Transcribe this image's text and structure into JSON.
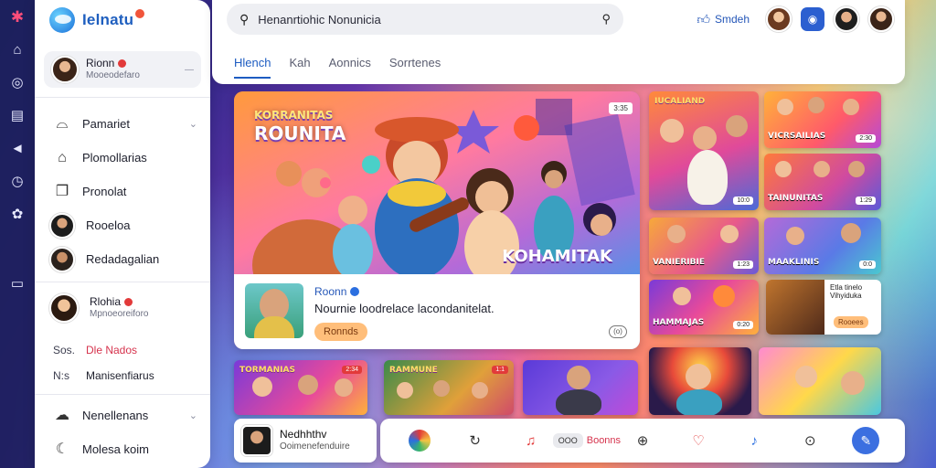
{
  "app": {
    "brand_name": "Ielnatu",
    "search_value": "Henanrtiohic Nonunicia"
  },
  "header": {
    "subscribe_label": "Smdeh",
    "tabs": [
      {
        "label": "Hlench",
        "active": true
      },
      {
        "label": "Kah",
        "active": false
      },
      {
        "label": "Aonnics",
        "active": false
      },
      {
        "label": "Sorrtenes",
        "active": false
      }
    ]
  },
  "sidebar": {
    "profile": {
      "name": "Rionn",
      "sub": "Mooeodefaro"
    },
    "items": [
      {
        "label": "Pamariet",
        "icon": "tent-icon",
        "has_chevron": true
      },
      {
        "label": "Plomollarias",
        "icon": "home-icon"
      },
      {
        "label": "Pronolat",
        "icon": "copy-icon"
      },
      {
        "label": "Rooeloa",
        "icon": "avatar"
      },
      {
        "label": "Redadagalian",
        "icon": "avatar"
      }
    ],
    "profile2": {
      "name": "Rlohia",
      "sub": "Mpnoeoreiforo"
    },
    "mini_rows": [
      {
        "key": "Sos.",
        "value": "Dle Nados",
        "hot": true
      },
      {
        "key": "N:s",
        "value": "Manisenfiarus",
        "hot": false
      }
    ],
    "bottom_items": [
      {
        "label": "Nenellenans",
        "icon": "cloud-icon",
        "has_chevron": true
      },
      {
        "label": "Molesa koim",
        "icon": "moon-icon"
      }
    ]
  },
  "hero": {
    "title_line1": "KORRANITAS",
    "title_line2": "ROUNITA",
    "brand_text": "KOHAMITAK",
    "badge": "3:35",
    "channel": "Roonn",
    "description": "Nournie loodrelace lacondanitelat.",
    "pill": "Ronnds",
    "more": "(o)"
  },
  "grid": {
    "t1": {
      "caption": "IUCALIAND",
      "duration": "10:0"
    },
    "t2": {
      "caption": "VICRSAILIAS",
      "duration": "2:30"
    },
    "t3": {
      "caption": "TAINUNITAS",
      "duration": "1:29"
    },
    "t4": {
      "caption": "VANIERIBIE",
      "duration": "1:23"
    },
    "t5": {
      "caption": "MAAKLINIS",
      "duration": "0:0"
    },
    "t6": {
      "caption": "HAMMAJAS",
      "duration": "0:20"
    },
    "t7": {
      "caption": "TORMANIAS",
      "tag": "2:34"
    },
    "t8": {
      "caption": "RAMMUNE",
      "tag": "1:1"
    },
    "side": {
      "text": "Etla tinelo Vihyiduka",
      "pill": "Rooees"
    }
  },
  "player": {
    "title": "Nedhhthv",
    "sub": "Ooimenefenduire"
  },
  "dock": {
    "pill": "OOO",
    "label": "Boonns"
  },
  "colors": {
    "accent": "#1d5cc1",
    "hot": "#d6334d",
    "fab": "#3b6fe0"
  }
}
